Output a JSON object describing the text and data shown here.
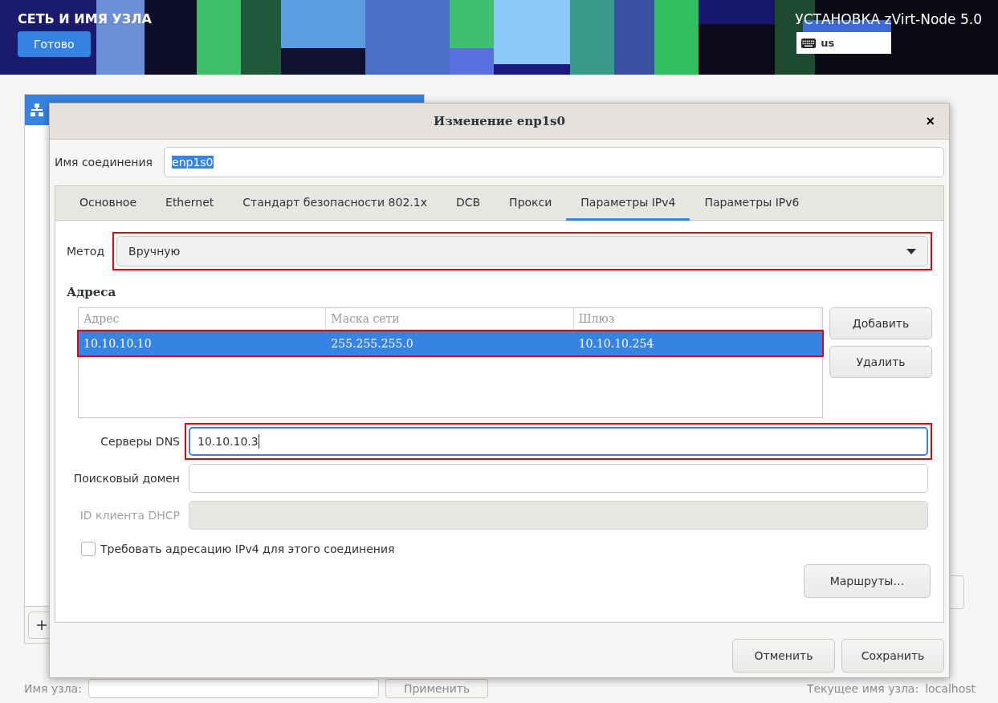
{
  "header": {
    "title": "СЕТЬ И ИМЯ УЗЛА",
    "done_button": "Готово",
    "product": "УСТАНОВКА zVirt-Node 5.0",
    "keyboard_layout": "us"
  },
  "background": {
    "device_item_selected": true,
    "hostname_label": "Имя узла:",
    "apply_button": "Применить",
    "current_hostname_label": "Текущее имя узла:",
    "current_hostname": "localhost"
  },
  "dialog": {
    "title": "Изменение enp1s0",
    "close": "×",
    "connection_name_label": "Имя соединения",
    "connection_name": "enp1s0",
    "connection_name_selected": true,
    "tabs": [
      {
        "label": "Основное",
        "selected": false
      },
      {
        "label": "Ethernet",
        "selected": false
      },
      {
        "label": "Стандарт безопасности 802.1x",
        "selected": false
      },
      {
        "label": "DCB",
        "selected": false
      },
      {
        "label": "Прокси",
        "selected": false
      },
      {
        "label": "Параметры IPv4",
        "selected": true
      },
      {
        "label": "Параметры IPv6",
        "selected": false
      }
    ],
    "method_label": "Метод",
    "method": "Вручную",
    "method_highlighted": true,
    "addresses_heading": "Адреса",
    "address_columns": [
      "Адрес",
      "Маска сети",
      "Шлюз"
    ],
    "address_rows": [
      {
        "cells": [
          "10.10.10.10",
          "255.255.255.0",
          "10.10.10.254"
        ],
        "selected": true,
        "highlighted": true
      }
    ],
    "add_button": "Добавить",
    "delete_button": "Удалить",
    "fields": [
      {
        "label": "Серверы DNS",
        "value": "10.10.10.3",
        "focused": true,
        "highlighted": true,
        "disabled": false
      },
      {
        "label": "Поисковый домен",
        "focused": false,
        "highlighted": false,
        "disabled": false
      },
      {
        "label": "ID клиента DHCP",
        "focused": false,
        "highlighted": false,
        "disabled": true
      }
    ],
    "require_ipv4": {
      "label": "Требовать адресацию IPv4 для этого соединения",
      "checked": false
    },
    "routes_button": "Маршруты…",
    "cancel_button": "Отменить",
    "save_button": "Сохранить"
  }
}
